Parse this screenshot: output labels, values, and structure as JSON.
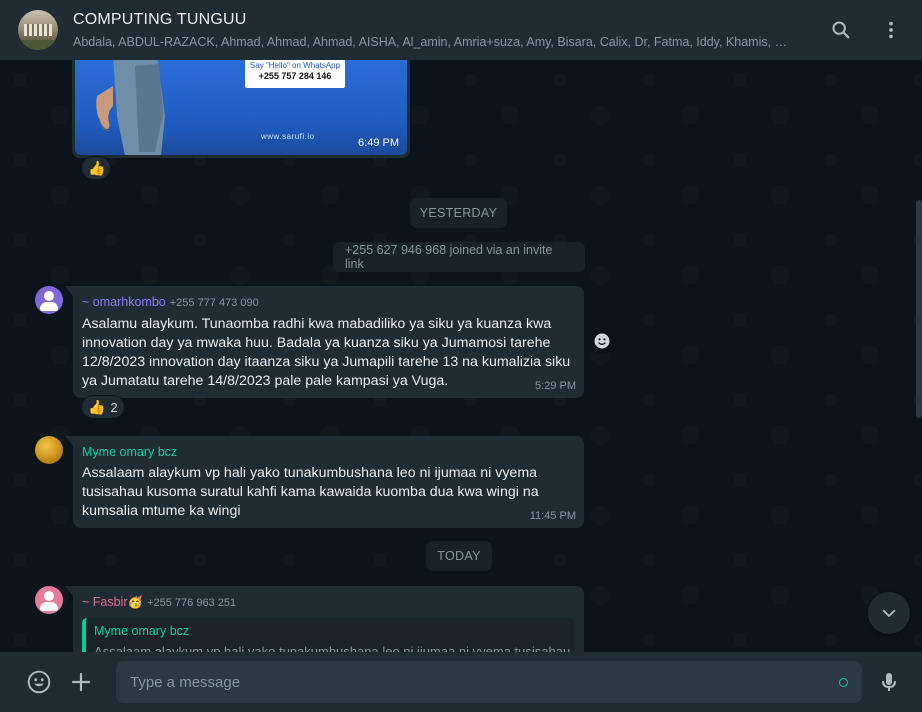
{
  "header": {
    "title": "COMPUTING TUNGUU",
    "members": "Abdala, ABDUL-RAZACK, Ahmad, Ahmad, Ahmad, AISHA, Al_amin, Amria+suza, Amy, Bisara, Calix, Dr, Fatma, Iddy, Khamis, Mohamed, Mwanaisha",
    "icons": [
      "search-icon",
      "menu-icon"
    ]
  },
  "image_message": {
    "card_line1": "Say \"Hello\" on WhatsApp",
    "card_phone": "+255 757 284 146",
    "site": "www.sarufi.io",
    "time": "6:49 PM",
    "reaction": "👍"
  },
  "separators": {
    "yesterday": "YESTERDAY",
    "today": "TODAY"
  },
  "system": {
    "joined": "+255 627 946 968 joined via an invite link"
  },
  "messages": [
    {
      "sender": "~ omarhkombo",
      "phone": "+255 777 473 090",
      "sender_color": "#8b7cf6",
      "text": "Asalamu alaykum. Tunaomba radhi kwa mabadiliko ya siku ya kuanza kwa innovation day ya mwaka huu. Badala ya kuanza siku ya Jumamosi tarehe 12/8/2023 innovation day itaanza siku ya Jumapili tarehe 13 na kumalizia siku ya Jumatatu tarehe 14/8/2023 pale pale kampasi ya Vuga.",
      "time": "5:29 PM",
      "reaction_emoji": "👍",
      "reaction_count": "2"
    },
    {
      "sender": "Myme omary bcz",
      "phone": "",
      "sender_color": "#06cf9c",
      "text": "Assalaam alaykum vp hali yako tunakumbushana leo ni ijumaa ni vyema tusisahau kusoma suratul kahfi kama kawaida kuomba dua kwa wingi na kumsalia mtume ka wingi",
      "time": "11:45 PM"
    },
    {
      "sender": "~ Fasbir🥳",
      "phone": "+255 776 963 251",
      "sender_color": "#e26b8f",
      "quote_name": "Myme omary bcz",
      "quote_text": "Assalaam alaykum vp hali yako tunakumbushana leo ni ijumaa ni vyema tusisahau"
    }
  ],
  "footer": {
    "placeholder": "Type a message",
    "icons": [
      "emoji-icon",
      "plus-icon",
      "mic-icon"
    ]
  },
  "colors": {
    "background": "#0b141a",
    "panel": "#202c33",
    "bubble": "#202c33",
    "accent": "#06cf9c",
    "muted": "#8696a0"
  }
}
